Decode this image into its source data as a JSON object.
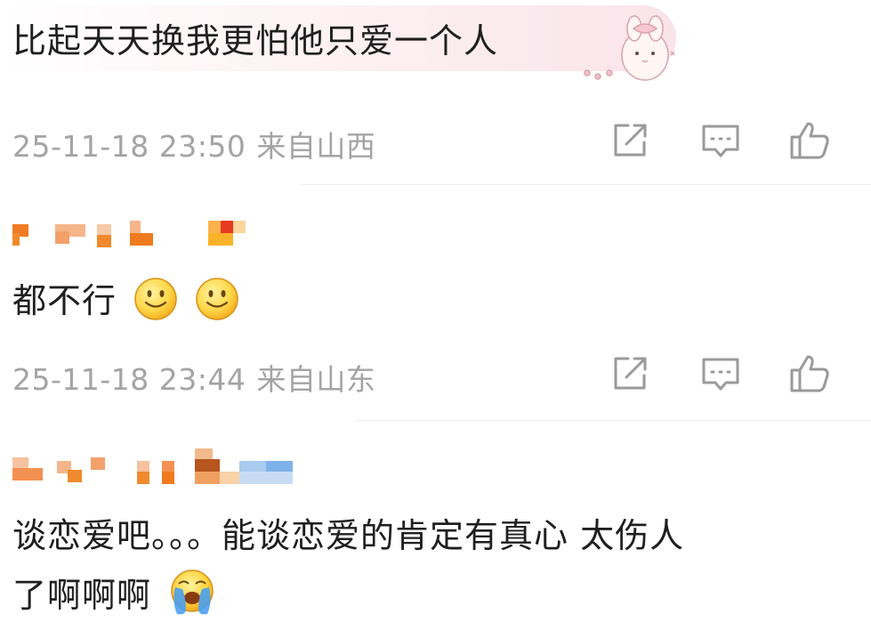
{
  "comments": [
    {
      "text": "比起天天换我更怕他只爱一个人",
      "date": "25-11-18 23:50",
      "location": "来自山西",
      "has_sticker": true
    },
    {
      "username_redacted": true,
      "text": "都不行",
      "emojis": [
        "smile-emoji",
        "smile-emoji"
      ],
      "date": "25-11-18 23:44",
      "location": "来自山东"
    },
    {
      "username_redacted": true,
      "text_line1": "谈恋爱吧。。。能谈恋爱的肯定有真心 太伤人",
      "text_line2": "了啊啊啊",
      "emojis": [
        "crying-emoji"
      ]
    }
  ],
  "icons": {
    "share": "share-icon",
    "comment": "comment-icon",
    "like": "like-icon"
  },
  "colors": {
    "text": "#1f1f1f",
    "meta": "#a4a4a4",
    "icon": "#9a9a9a",
    "bubble_pink": "#f9e4ea",
    "emoji_yellow": "#f7c21e",
    "mosaic_orange": "#f08a2c"
  }
}
